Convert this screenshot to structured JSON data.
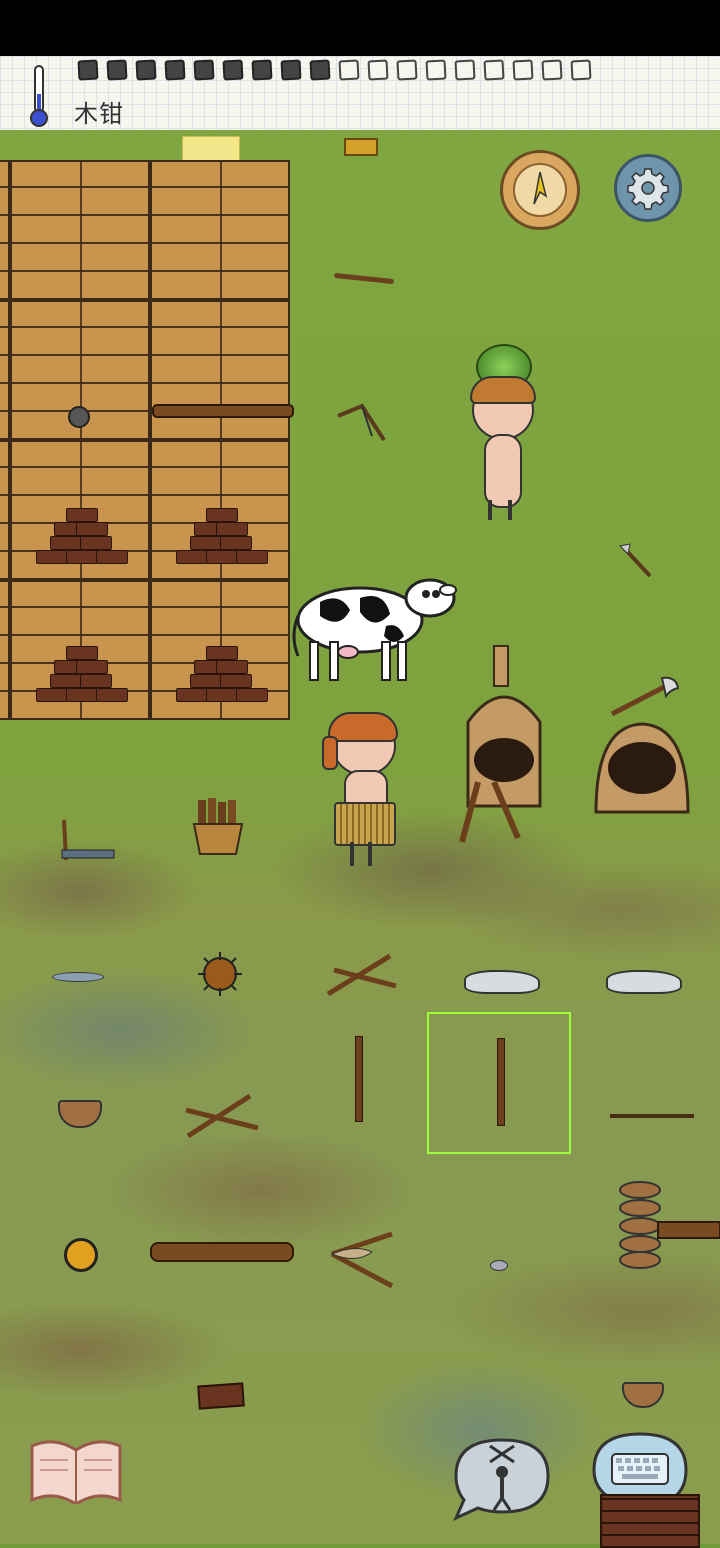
{
  "hud": {
    "held_item_label": "木钳",
    "food_pips_filled": 9,
    "food_pips_total": 18
  },
  "icons": {
    "thermometer": "thermometer-icon",
    "compass": "compass-icon",
    "settings": "gear-icon",
    "book": "tech-book-icon",
    "emote": "puppet-speech-icon",
    "keyboard": "keyboard-speech-icon"
  },
  "colors": {
    "hud_bg": "#f6f5ee",
    "grass": "#7fa640",
    "selection": "#9cff3a",
    "settings_blue": "#6f95ad",
    "compass_gold": "#d9a760"
  }
}
